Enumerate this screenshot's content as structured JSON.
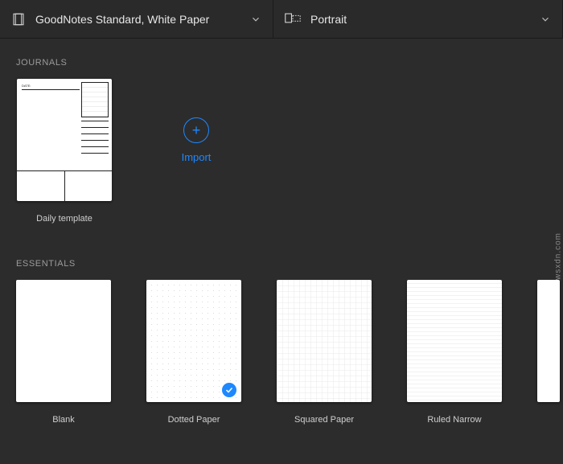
{
  "toolbar": {
    "paper_label": "GoodNotes Standard, White Paper",
    "orientation_label": "Portrait"
  },
  "sections": {
    "journals": {
      "title": "JOURNALS",
      "items": [
        "Daily template"
      ],
      "import_label": "Import"
    },
    "essentials": {
      "title": "ESSENTIALS",
      "items": [
        "Blank",
        "Dotted Paper",
        "Squared Paper",
        "Ruled Narrow"
      ],
      "selected_index": 1
    }
  },
  "accent": "#1e88ff",
  "watermark": "wsxdn.com"
}
